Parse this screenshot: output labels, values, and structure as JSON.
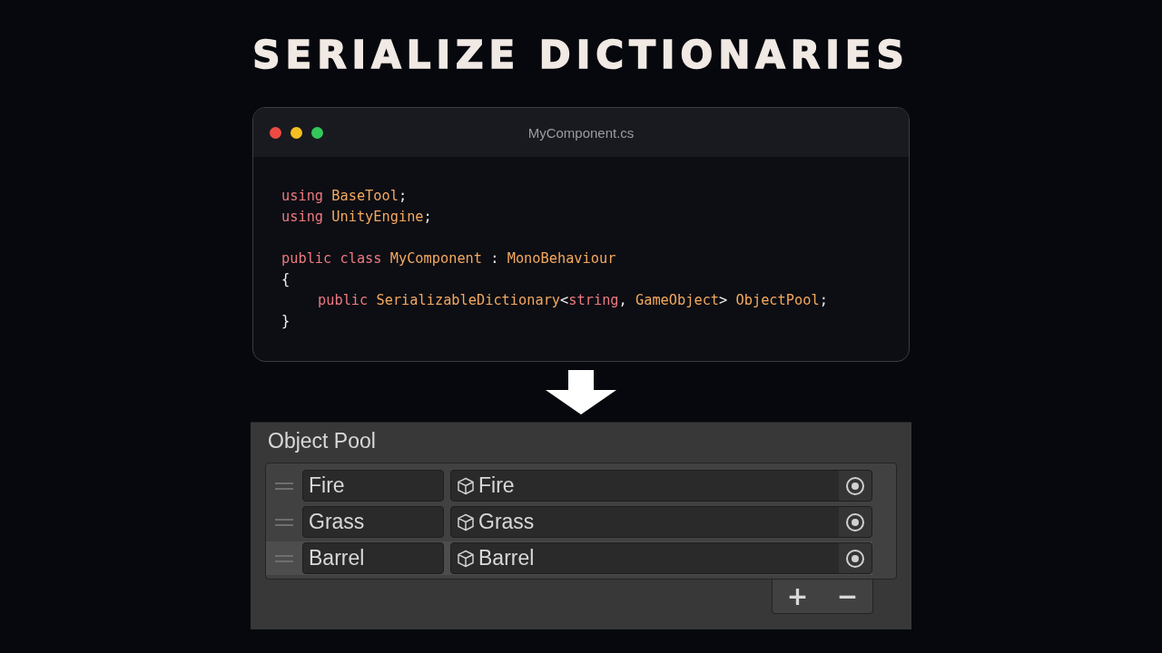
{
  "heading": "SERIALIZE DICTIONARIES",
  "editor": {
    "title": "MyComponent.cs",
    "lines": [
      {
        "kind": "plain",
        "tokens": [
          {
            "text": "using ",
            "kind": "keyword"
          },
          {
            "text": "BaseTool",
            "kind": "type"
          },
          {
            "text": ";",
            "kind": "plain"
          }
        ]
      },
      {
        "kind": "plain",
        "tokens": [
          {
            "text": "using ",
            "kind": "keyword"
          },
          {
            "text": "UnityEngine",
            "kind": "type"
          },
          {
            "text": ";",
            "kind": "plain"
          }
        ]
      },
      {
        "kind": "blank"
      },
      {
        "kind": "plain",
        "tokens": [
          {
            "text": "public ",
            "kind": "keyword"
          },
          {
            "text": "class ",
            "kind": "keyword"
          },
          {
            "text": "MyComponent ",
            "kind": "type"
          },
          {
            "text": ": ",
            "kind": "plain"
          },
          {
            "text": "MonoBehaviour",
            "kind": "type"
          }
        ]
      },
      {
        "kind": "plain",
        "tokens": [
          {
            "text": "{",
            "kind": "plain"
          }
        ]
      },
      {
        "kind": "indented",
        "tokens": [
          {
            "text": "public ",
            "kind": "keyword"
          },
          {
            "text": "SerializableDictionary",
            "kind": "type"
          },
          {
            "text": "<",
            "kind": "plain"
          },
          {
            "text": "string",
            "kind": "keyword"
          },
          {
            "text": ", ",
            "kind": "plain"
          },
          {
            "text": "GameObject",
            "kind": "type"
          },
          {
            "text": "> ",
            "kind": "plain"
          },
          {
            "text": "ObjectPool",
            "kind": "type"
          },
          {
            "text": ";",
            "kind": "plain"
          }
        ]
      },
      {
        "kind": "plain",
        "tokens": [
          {
            "text": "}",
            "kind": "plain"
          }
        ]
      }
    ]
  },
  "inspector": {
    "label": "Object Pool",
    "rows": [
      {
        "key": "Fire",
        "value": "Fire",
        "selected": false
      },
      {
        "key": "Grass",
        "value": "Grass",
        "selected": false
      },
      {
        "key": "Barrel",
        "value": "Barrel",
        "selected": true
      }
    ],
    "buttons": [
      "+",
      "−"
    ]
  }
}
